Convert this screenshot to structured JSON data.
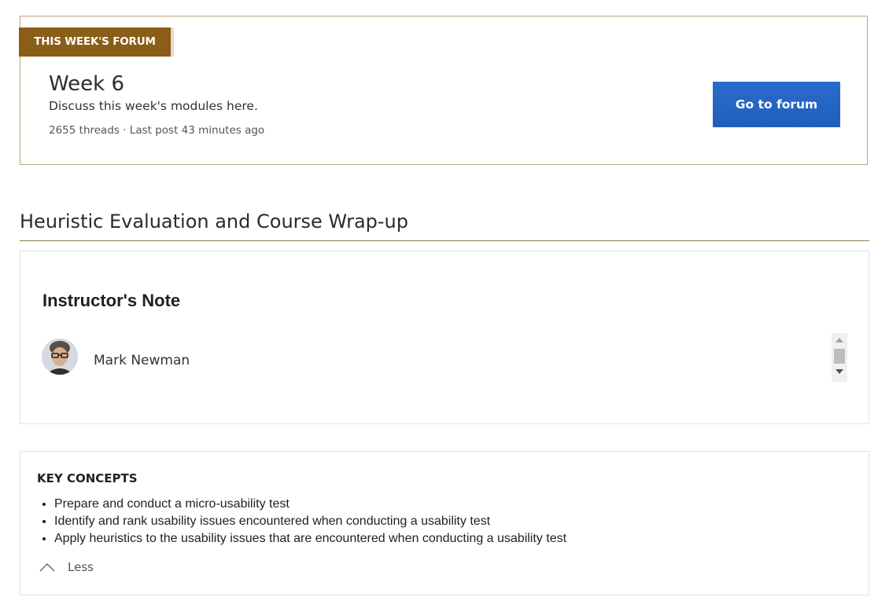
{
  "forum": {
    "tag": "THIS WEEK'S FORUM",
    "title": "Week 6",
    "description": "Discuss this week's modules here.",
    "meta": "2655 threads · Last post 43 minutes ago",
    "button_label": "Go to forum"
  },
  "section": {
    "title": "Heuristic Evaluation and Course Wrap-up"
  },
  "instructor_note": {
    "heading": "Instructor's Note",
    "instructor_name": "Mark Newman"
  },
  "key_concepts": {
    "heading": "KEY CONCEPTS",
    "items": [
      "Prepare and conduct a micro-usability test",
      "Identify and rank usability issues encountered when conducting a usability test",
      "Apply heuristics to the usability issues that are encountered when conducting a usability test"
    ],
    "toggle_label": "Less"
  },
  "colors": {
    "forum_tag": "#8a5e16",
    "button": "#2a6ccd",
    "section_rule": "#8c7a45",
    "card_border_gold": "#b8a582"
  }
}
